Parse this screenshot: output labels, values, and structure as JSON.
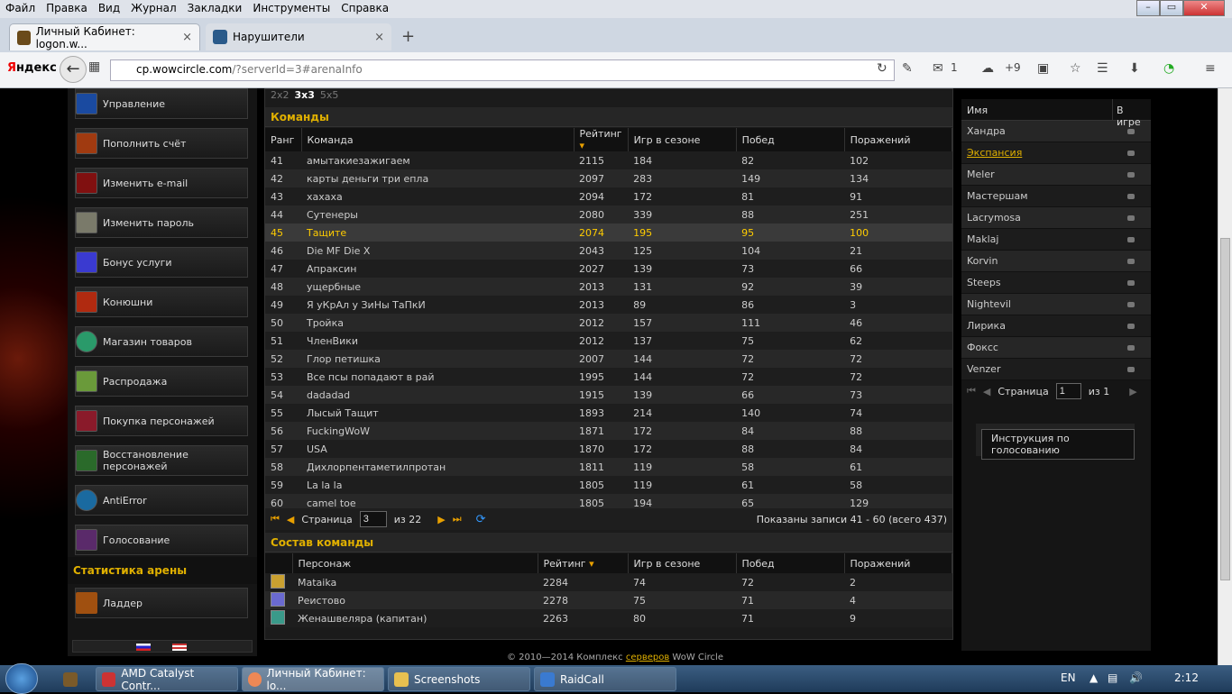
{
  "menubar": [
    "Файл",
    "Правка",
    "Вид",
    "Журнал",
    "Закладки",
    "Инструменты",
    "Справка"
  ],
  "tabs": [
    {
      "label": "Личный Кабинет: logon.w...",
      "close": "×"
    },
    {
      "label": "Нарушители",
      "close": "×"
    }
  ],
  "new_tab": "+",
  "nav": {
    "brand_first": "Я",
    "brand_rest": "ндекс",
    "url_domain": "cp.wowcircle.com",
    "url_path": "/?serverId=3#arenaInfo",
    "mail_count": "1",
    "weather": "+9"
  },
  "sidebar": {
    "items": [
      "Управление",
      "Пополнить счёт",
      "Изменить e-mail",
      "Изменить пароль",
      "Бонус услуги",
      "Конюшни",
      "Магазин товаров",
      "Распродажа",
      "Покупка персонажей",
      "Восстановление персонажей",
      "AntiError",
      "Голосование"
    ],
    "arena_title": "Статистика арены",
    "ladder": "Ладдер"
  },
  "size_tabs": [
    "2x2",
    "3x3",
    "5x5"
  ],
  "teams": {
    "title": "Команды",
    "headers": [
      "Ранг",
      "Команда",
      "Рейтинг",
      "Игр в сезоне",
      "Побед",
      "Поражений"
    ],
    "rows": [
      [
        "41",
        "амытакиезажигаем",
        "2115",
        "184",
        "82",
        "102"
      ],
      [
        "42",
        "карты деньги три епла",
        "2097",
        "283",
        "149",
        "134"
      ],
      [
        "43",
        "хахаха",
        "2094",
        "172",
        "81",
        "91"
      ],
      [
        "44",
        "Сутенеры",
        "2080",
        "339",
        "88",
        "251"
      ],
      [
        "45",
        "Тащите",
        "2074",
        "195",
        "95",
        "100"
      ],
      [
        "46",
        "Die MF Die X",
        "2043",
        "125",
        "104",
        "21"
      ],
      [
        "47",
        "Апраксин",
        "2027",
        "139",
        "73",
        "66"
      ],
      [
        "48",
        "ущербные",
        "2013",
        "131",
        "92",
        "39"
      ],
      [
        "49",
        "Я уКрАл у ЗиНы ТаПкИ",
        "2013",
        "89",
        "86",
        "3"
      ],
      [
        "50",
        "Тройка",
        "2012",
        "157",
        "111",
        "46"
      ],
      [
        "51",
        "ЧленВики",
        "2012",
        "137",
        "75",
        "62"
      ],
      [
        "52",
        "Глор петишка",
        "2007",
        "144",
        "72",
        "72"
      ],
      [
        "53",
        "Все псы попадают в рай",
        "1995",
        "144",
        "72",
        "72"
      ],
      [
        "54",
        "dadadad",
        "1915",
        "139",
        "66",
        "73"
      ],
      [
        "55",
        "Лысый Тащит",
        "1893",
        "214",
        "140",
        "74"
      ],
      [
        "56",
        "FuckingWoW",
        "1871",
        "172",
        "84",
        "88"
      ],
      [
        "57",
        "USA",
        "1870",
        "172",
        "88",
        "84"
      ],
      [
        "58",
        "Дихлорпентаметилпротан",
        "1811",
        "119",
        "58",
        "61"
      ],
      [
        "59",
        "La la la",
        "1805",
        "119",
        "61",
        "58"
      ],
      [
        "60",
        "camel toe",
        "1805",
        "194",
        "65",
        "129"
      ]
    ],
    "pager": {
      "page_label": "Страница",
      "page": "3",
      "of": "из 22",
      "summary": "Показаны записи 41 - 60 (всего 437)"
    }
  },
  "roster": {
    "title": "Состав команды",
    "headers": [
      "Персонаж",
      "Рейтинг",
      "Игр в сезоне",
      "Побед",
      "Поражений"
    ],
    "rows": [
      [
        "Mataika",
        "2284",
        "74",
        "72",
        "2"
      ],
      [
        "Реистово",
        "2278",
        "75",
        "71",
        "4"
      ],
      [
        "Женашвеляра (капитан)",
        "2263",
        "80",
        "71",
        "9"
      ]
    ]
  },
  "footer": {
    "before": "© 2010—2014 Комплекс ",
    "link": "серверов",
    "after": " WoW Circle"
  },
  "players": {
    "headers": [
      "Имя",
      "В игре"
    ],
    "rows": [
      "Хандра",
      "Экспансия",
      "Meler",
      "Мастершам",
      "Lacrymosa",
      "Maklaj",
      "Korvin",
      "Steeps",
      "Nightevil",
      "Лирика",
      "Фоксс",
      "Venzer"
    ],
    "page_label": "Страница",
    "page": "1",
    "of": "из 1",
    "vote_button": "Инструкция по голосованию"
  },
  "taskbar": {
    "items": [
      "AMD Catalyst Contr...",
      "Личный Кабинет: lo...",
      "Screenshots",
      "RaidCall"
    ],
    "lang": "EN",
    "time": "2:12"
  }
}
